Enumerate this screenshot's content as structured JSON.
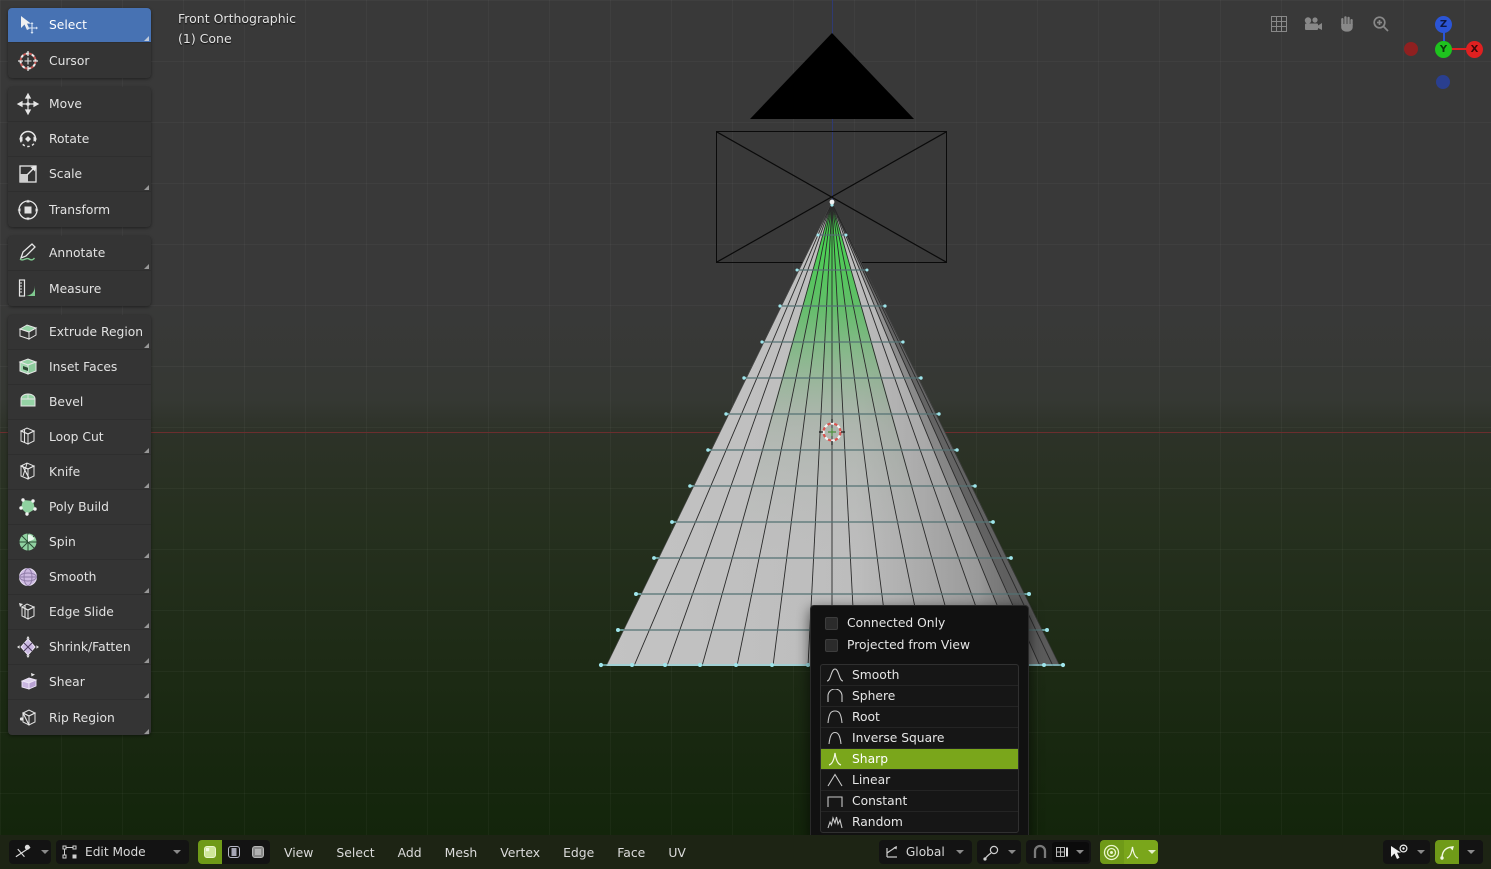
{
  "app": {
    "name": "Blender",
    "editor": "3D Viewport"
  },
  "viewport": {
    "view_name": "Front Orthographic",
    "active_object": "(1) Cone",
    "background_top_color": "#393939",
    "background_bottom_color": "#13250b",
    "axis_x_color": "#6b2e2e",
    "axis_z_color": "#2f3a72",
    "mesh_edge_color": "#8fd9e0",
    "mesh_face_color": "#b8b8b8",
    "influence_color": "#2fbf3a",
    "overlay_icons": [
      {
        "name": "grid-icon",
        "glyph": "grid"
      },
      {
        "name": "camera-icon",
        "glyph": "camera"
      },
      {
        "name": "hand-icon",
        "glyph": "hand"
      },
      {
        "name": "zoom-icon",
        "glyph": "magnifier"
      }
    ],
    "gizmo": {
      "axes": [
        {
          "label": "Z",
          "color": "#2b55d6"
        },
        {
          "label": "Y",
          "color": "#1ec31e"
        },
        {
          "label": "X",
          "color": "#e02020"
        }
      ]
    }
  },
  "toolbar": {
    "groups": [
      {
        "items": [
          {
            "label": "Select",
            "icon": "select-box-icon",
            "active": true,
            "has_submenu": true
          },
          {
            "label": "Cursor",
            "icon": "cursor-3d-icon",
            "active": false,
            "has_submenu": false
          }
        ]
      },
      {
        "items": [
          {
            "label": "Move",
            "icon": "move-icon",
            "active": false,
            "has_submenu": false
          },
          {
            "label": "Rotate",
            "icon": "rotate-icon",
            "active": false,
            "has_submenu": false
          },
          {
            "label": "Scale",
            "icon": "scale-icon",
            "active": false,
            "has_submenu": true
          },
          {
            "label": "Transform",
            "icon": "transform-icon",
            "active": false,
            "has_submenu": false
          }
        ]
      },
      {
        "items": [
          {
            "label": "Annotate",
            "icon": "annotate-pencil-icon",
            "active": false,
            "has_submenu": true
          },
          {
            "label": "Measure",
            "icon": "measure-ruler-icon",
            "active": false,
            "has_submenu": false
          }
        ]
      },
      {
        "items": [
          {
            "label": "Extrude Region",
            "icon": "extrude-region-icon",
            "active": false,
            "has_submenu": true
          },
          {
            "label": "Inset Faces",
            "icon": "inset-faces-icon",
            "active": false,
            "has_submenu": false
          },
          {
            "label": "Bevel",
            "icon": "bevel-icon",
            "active": false,
            "has_submenu": false
          },
          {
            "label": "Loop Cut",
            "icon": "loop-cut-icon",
            "active": false,
            "has_submenu": true
          },
          {
            "label": "Knife",
            "icon": "knife-icon",
            "active": false,
            "has_submenu": true
          },
          {
            "label": "Poly Build",
            "icon": "poly-build-icon",
            "active": false,
            "has_submenu": false
          },
          {
            "label": "Spin",
            "icon": "spin-icon",
            "active": false,
            "has_submenu": true
          },
          {
            "label": "Smooth",
            "icon": "smooth-icon",
            "active": false,
            "has_submenu": true
          },
          {
            "label": "Edge Slide",
            "icon": "edge-slide-icon",
            "active": false,
            "has_submenu": true
          },
          {
            "label": "Shrink/Fatten",
            "icon": "shrink-fatten-icon",
            "active": false,
            "has_submenu": true
          },
          {
            "label": "Shear",
            "icon": "shear-icon",
            "active": false,
            "has_submenu": true
          },
          {
            "label": "Rip Region",
            "icon": "rip-region-icon",
            "active": false,
            "has_submenu": true
          }
        ]
      }
    ]
  },
  "falloff_menu": {
    "checkboxes": [
      {
        "label": "Connected Only",
        "checked": false
      },
      {
        "label": "Projected from View",
        "checked": false
      }
    ],
    "selected": "Sharp",
    "highlight_color": "#7aa61b",
    "items": [
      {
        "label": "Smooth",
        "curve": "smooth",
        "selected": false
      },
      {
        "label": "Sphere",
        "curve": "sphere",
        "selected": false
      },
      {
        "label": "Root",
        "curve": "root",
        "selected": false
      },
      {
        "label": "Inverse Square",
        "curve": "inverse-square",
        "selected": false
      },
      {
        "label": "Sharp",
        "curve": "sharp",
        "selected": true
      },
      {
        "label": "Linear",
        "curve": "linear",
        "selected": false
      },
      {
        "label": "Constant",
        "curve": "constant",
        "selected": false
      },
      {
        "label": "Random",
        "curve": "random",
        "selected": false
      }
    ]
  },
  "bottom_bar": {
    "background_color": "#1d2414",
    "editor_type_label": "",
    "mode": "Edit Mode",
    "select_modes": [
      {
        "name": "vertex-select-mode",
        "active": true
      },
      {
        "name": "edge-select-mode",
        "active": false
      },
      {
        "name": "face-select-mode",
        "active": false
      }
    ],
    "menus": [
      "View",
      "Select",
      "Add",
      "Mesh",
      "Vertex",
      "Edge",
      "Face",
      "UV"
    ],
    "transform_orientation": "Global",
    "snap_enabled": false,
    "proportional_editing_enabled": true,
    "proportional_falloff": "Sharp",
    "right_tools": [
      {
        "name": "visibility-selectability-button",
        "active": false
      },
      {
        "name": "gizmo-button",
        "active": true
      }
    ]
  }
}
